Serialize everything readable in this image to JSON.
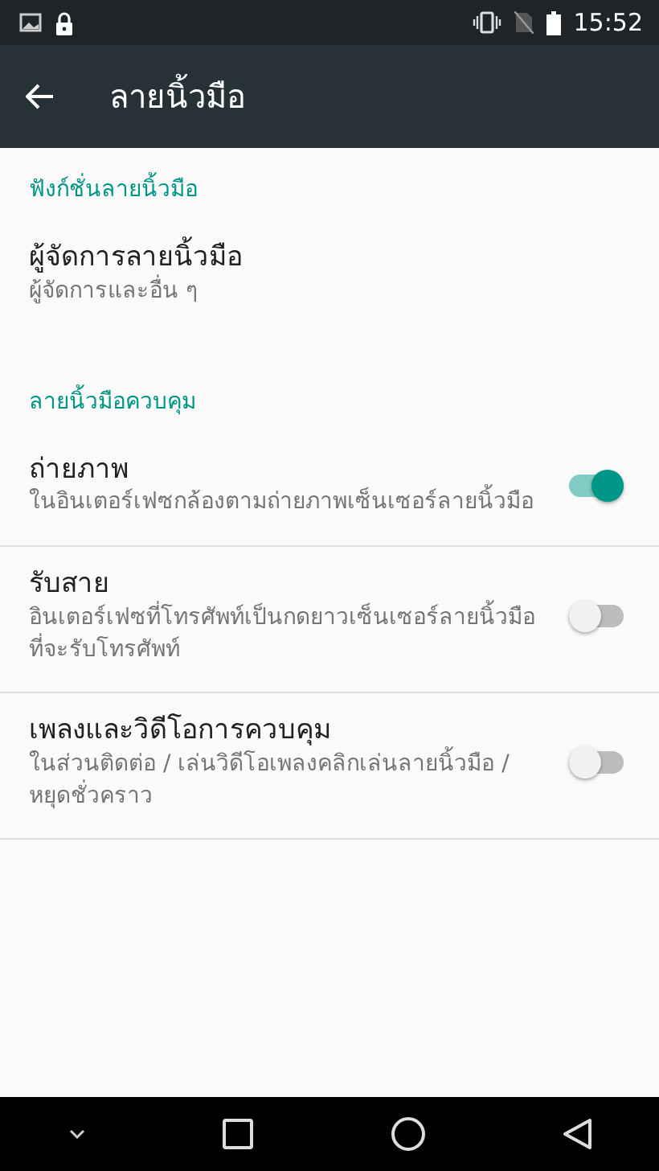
{
  "status_bar": {
    "time": "15:52"
  },
  "toolbar": {
    "title": "ลายนิ้วมือ"
  },
  "sections": [
    {
      "header": "ฟังก์ชั่นลายนิ้วมือ",
      "items": [
        {
          "kind": "link",
          "title": "ผู้จัดการลายนิ้วมือ",
          "summary": "ผู้จัดการและอื่น ๆ"
        }
      ]
    },
    {
      "header": "ลายนิ้วมือควบคุม",
      "items": [
        {
          "kind": "switch",
          "title": "ถ่ายภาพ",
          "summary": "ในอินเตอร์เฟซกล้องตามถ่ายภาพเซ็นเซอร์ลายนิ้วมือ",
          "on": true
        },
        {
          "kind": "switch",
          "title": "รับสาย",
          "summary": "อินเตอร์เฟซที่โทรศัพท์เป็นกดยาวเซ็นเซอร์ลายนิ้วมือที่จะรับโทรศัพท์",
          "on": false
        },
        {
          "kind": "switch",
          "title": "เพลงและวิดีโอการควบคุม",
          "summary": "ในส่วนติดต่อ / เล่นวิดีโอเพลงคลิกเล่นลายนิ้วมือ / หยุดชั่วคราว",
          "on": false
        }
      ]
    }
  ]
}
